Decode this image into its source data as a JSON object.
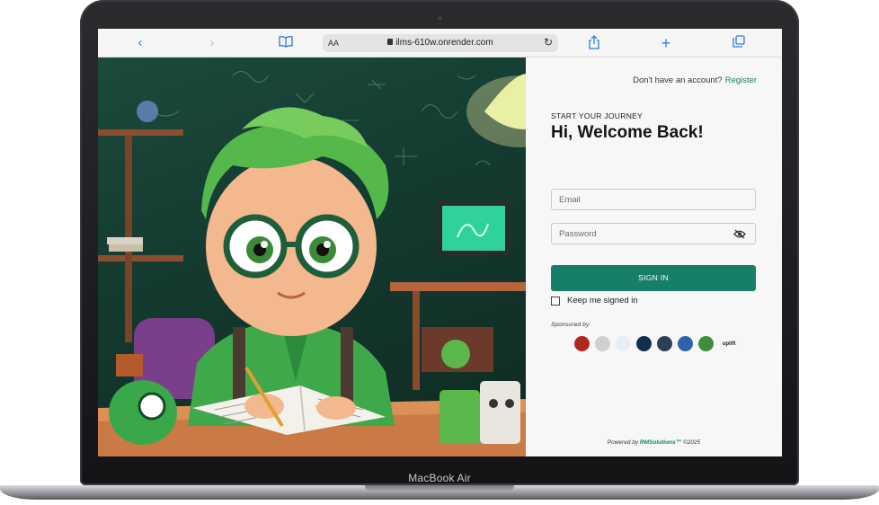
{
  "device": {
    "label": "MacBook Air"
  },
  "browser": {
    "reader_label": "AA",
    "url": "ilms-610w.onrender.com"
  },
  "auth": {
    "signup_prompt": "Don't have an account?",
    "register_label": "Register",
    "eyebrow": "START YOUR JOURNEY",
    "heading": "Hi, Welcome Back!",
    "email_placeholder": "Email",
    "password_placeholder": "Password",
    "signin_label": "SIGN IN",
    "keep_signed_in_label": "Keep me signed in",
    "keep_signed_in_checked": false
  },
  "sponsors": {
    "label": "Sponsored by:",
    "logos": [
      {
        "name": "sponsor-logo-1",
        "color": "#b3261e"
      },
      {
        "name": "sponsor-logo-2",
        "color": "#cfcfcf"
      },
      {
        "name": "sponsor-logo-3",
        "color": "#e9eef5"
      },
      {
        "name": "sponsor-logo-4",
        "color": "#0f2f4f"
      },
      {
        "name": "sponsor-logo-5",
        "color": "#2d3f54"
      },
      {
        "name": "sponsor-logo-6",
        "color": "#2f62a8"
      },
      {
        "name": "sponsor-logo-7",
        "color": "#3f8f3a"
      },
      {
        "name": "sponsor-logo-8",
        "color": "#1c1c1c",
        "text": "uplift"
      }
    ]
  },
  "footer": {
    "prefix": "Powered by ",
    "brand": "RMSolutions™",
    "suffix": " ©2025"
  },
  "colors": {
    "accent": "#167e69",
    "panel_bg": "#f7f7f7"
  }
}
